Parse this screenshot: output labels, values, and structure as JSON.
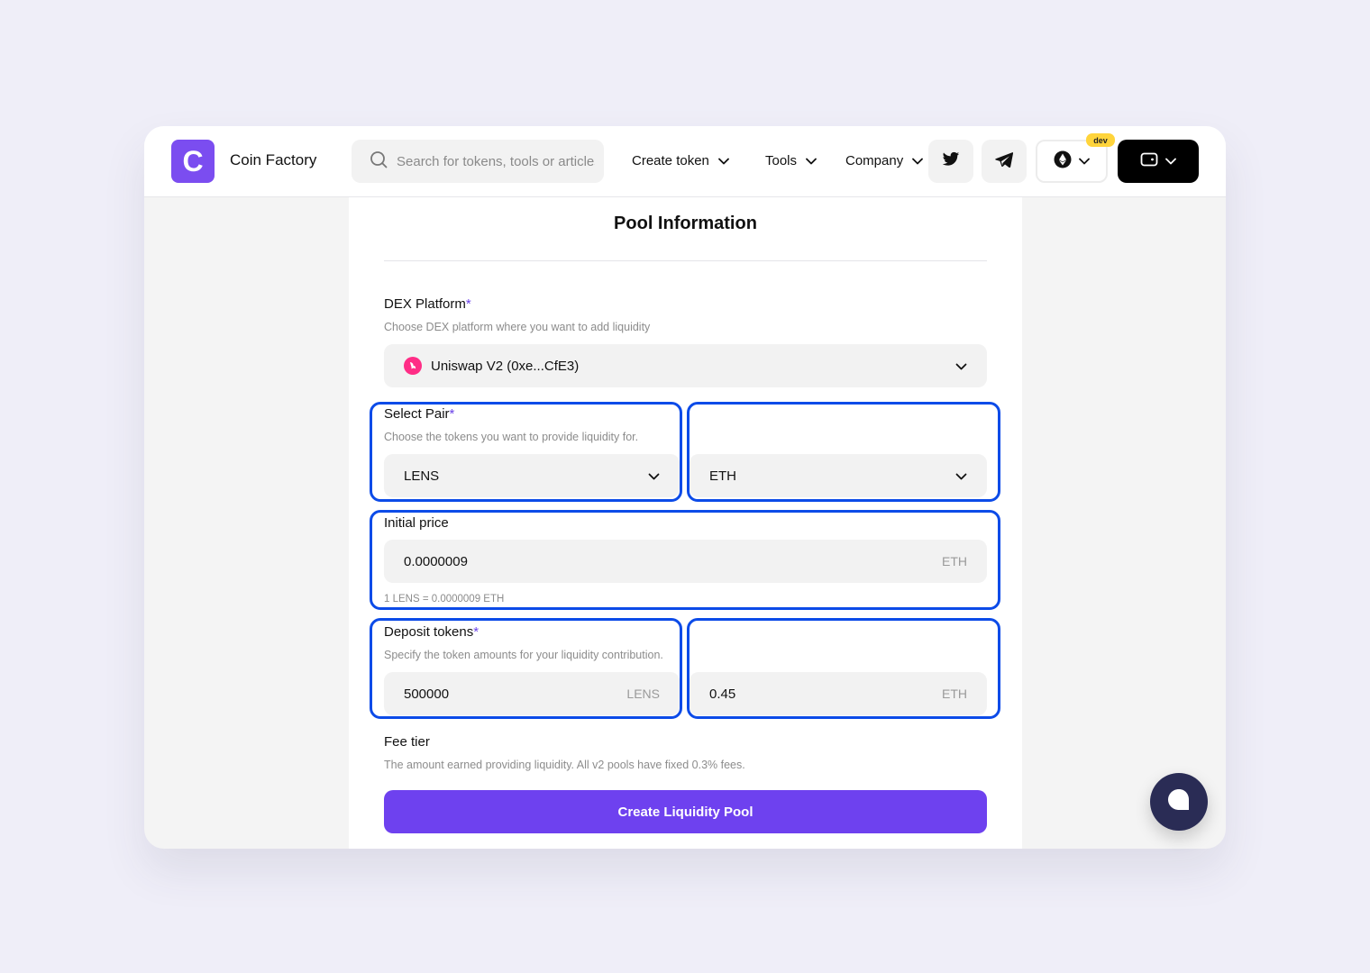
{
  "header": {
    "brand": "Coin Factory",
    "logo_letter": "C",
    "search_placeholder": "Search for tokens, tools or articles",
    "nav": [
      {
        "label": "Create token"
      },
      {
        "label": "Tools"
      },
      {
        "label": "Company"
      }
    ],
    "network_badge": "dev"
  },
  "form": {
    "title": "Pool Information",
    "dex": {
      "label": "DEX Platform",
      "required": "*",
      "help": "Choose DEX platform where you want to add liquidity",
      "value": "Uniswap V2 (0xe...CfE3)"
    },
    "pair": {
      "label": "Select Pair",
      "required": "*",
      "help": "Choose the tokens you want to provide liquidity for.",
      "token_a": "LENS",
      "token_b": "ETH"
    },
    "initial_price": {
      "label": "Initial price",
      "value": "0.0000009",
      "unit": "ETH",
      "hint": "1 LENS = 0.0000009 ETH"
    },
    "deposit": {
      "label": "Deposit tokens",
      "required": "*",
      "help": "Specify the token amounts for your liquidity contribution.",
      "amount_a": "500000",
      "unit_a": "LENS",
      "amount_b": "0.45",
      "unit_b": "ETH"
    },
    "fee": {
      "label": "Fee tier",
      "help": "The amount earned providing liquidity. All v2 pools have fixed 0.3% fees."
    },
    "submit_label": "Create Liquidity Pool"
  },
  "colors": {
    "accent": "#6e41ef",
    "highlight": "#0c4be8",
    "badge": "#ffd43b",
    "uniswap": "#ff2d86"
  }
}
